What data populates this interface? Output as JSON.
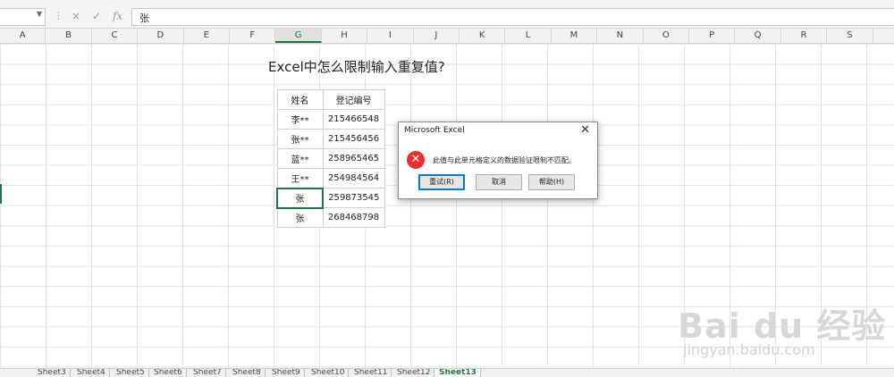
{
  "formula_bar": {
    "name_box_value": "",
    "cancel_icon": "×",
    "enter_icon": "✓",
    "fx_label": "fx",
    "content": "张"
  },
  "columns": [
    "A",
    "B",
    "C",
    "D",
    "E",
    "F",
    "G",
    "H",
    "I",
    "J",
    "K",
    "L",
    "M",
    "N",
    "O",
    "P",
    "Q",
    "R",
    "S"
  ],
  "selected_column": "G",
  "sheet_title": "Excel中怎么限制输入重复值?",
  "table": {
    "headers": [
      "姓名",
      "登记编号"
    ],
    "rows": [
      [
        "李**",
        "215466548"
      ],
      [
        "张**",
        "215456456"
      ],
      [
        "蓝**",
        "258965465"
      ],
      [
        "王**",
        "254984564"
      ],
      [
        "张",
        "259873545"
      ],
      [
        "张",
        "268468798"
      ]
    ]
  },
  "dialog": {
    "title": "Microsoft Excel",
    "close_icon": "✕",
    "error_icon": "✕",
    "message": "此值与此单元格定义的数据验证限制不匹配。",
    "retry_label": "重试(R)",
    "cancel_label": "取消",
    "help_label": "帮助(H)"
  },
  "sheets": [
    "Sheet3",
    "Sheet4",
    "Sheet5",
    "Sheet6",
    "Sheet7",
    "Sheet8",
    "Sheet9",
    "Sheet10",
    "Sheet11",
    "Sheet12",
    "Sheet13"
  ],
  "active_sheet": "Sheet13",
  "watermark": {
    "brand": "Bai du 经验",
    "url": "jingyan.baidu.com"
  },
  "colors": {
    "excel_green": "#217346",
    "error_red": "#e8312a",
    "default_button_blue": "#0078d7"
  }
}
